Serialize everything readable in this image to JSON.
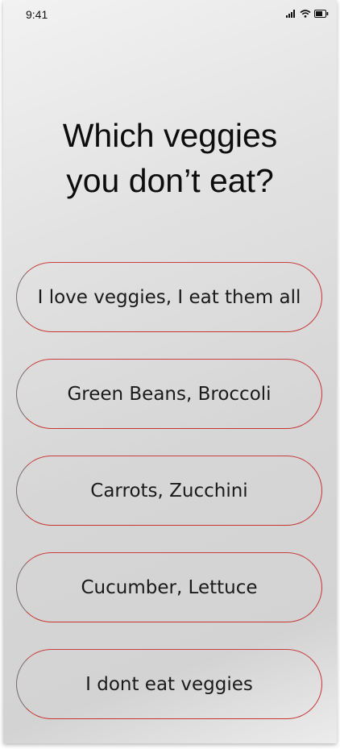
{
  "status_bar": {
    "time": "9:41",
    "icons": [
      "cellular-signal-icon",
      "wifi-icon",
      "battery-icon"
    ]
  },
  "question": {
    "line1": "Which veggies",
    "line2": "you don’t eat?"
  },
  "options": [
    {
      "label": "I love veggies, I eat them all"
    },
    {
      "label": "Green Beans, Broccoli"
    },
    {
      "label": "Carrots, Zucchini"
    },
    {
      "label": "Cucumber, Lettuce"
    },
    {
      "label": "I dont eat veggies"
    }
  ],
  "colors": {
    "option_border": "#c73434",
    "text": "#111111"
  }
}
